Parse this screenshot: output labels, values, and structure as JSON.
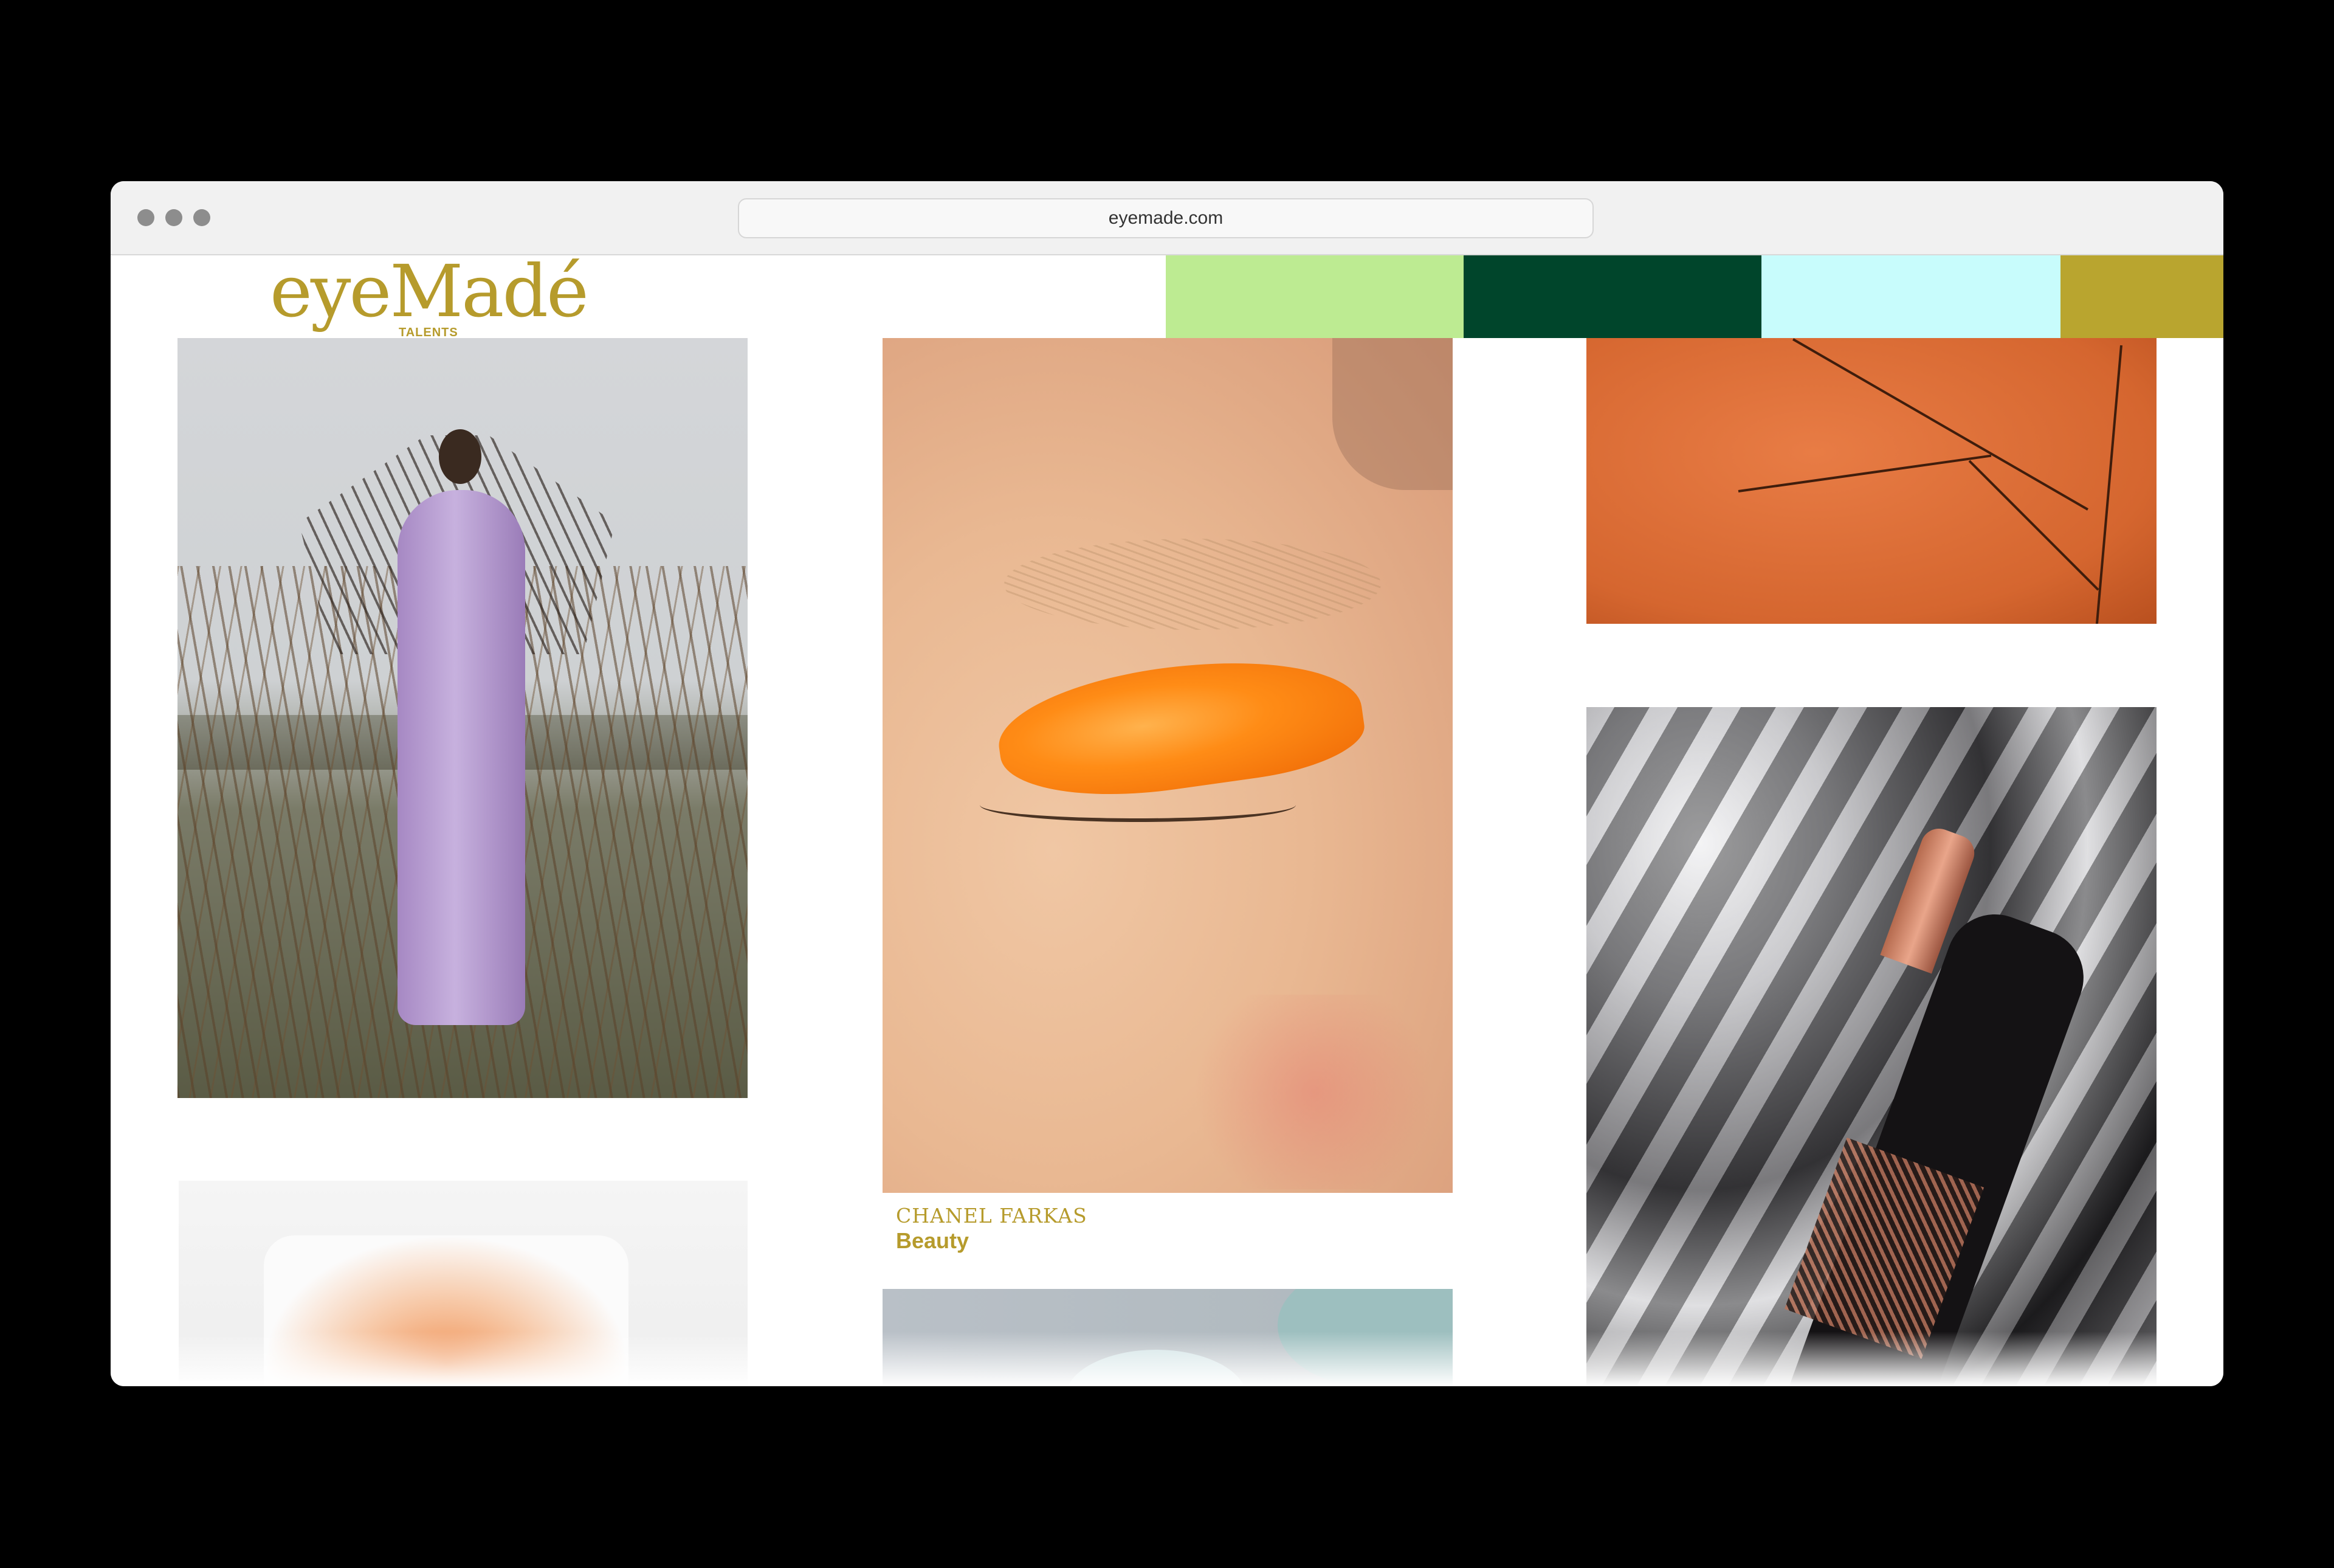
{
  "browser": {
    "url": "eyemade.com"
  },
  "brand": {
    "name": "eyeMadé",
    "tagline": "TALENTS",
    "color": "#b69b2c"
  },
  "palette": [
    "#bdeb92",
    "#00452b",
    "#c8fcfc",
    "#b9a52f"
  ],
  "feed": {
    "items": [
      {
        "name": "Chanel Farkas",
        "caption_name": "CHANEL FARKAS",
        "caption_category": "Beauty"
      }
    ]
  },
  "icons": {
    "window_controls": [
      "close-dot",
      "minimize-dot",
      "zoom-dot"
    ]
  }
}
